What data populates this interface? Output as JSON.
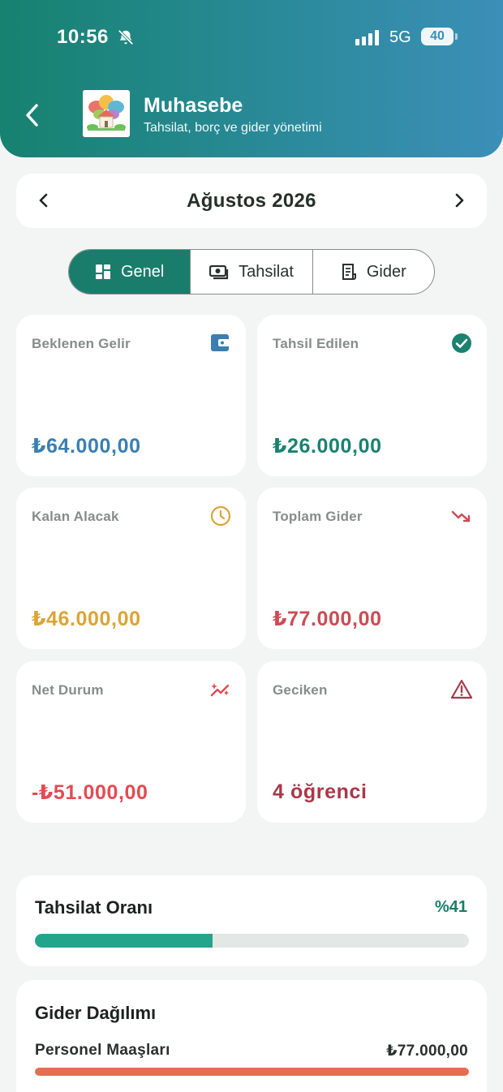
{
  "status_bar": {
    "time": "10:56",
    "network": "5G",
    "battery": "40"
  },
  "header": {
    "title": "Muhasebe",
    "subtitle": "Tahsilat, borç ve gider yönetimi"
  },
  "month_selector": {
    "label": "Ağustos 2026"
  },
  "tabs": [
    {
      "label": "Genel",
      "icon": "dashboard-grid-icon",
      "active": true
    },
    {
      "label": "Tahsilat",
      "icon": "cash-icon",
      "active": false
    },
    {
      "label": "Gider",
      "icon": "receipt-icon",
      "active": false
    }
  ],
  "stats": [
    {
      "label": "Beklenen Gelir",
      "value": "₺64.000,00",
      "icon": "wallet-icon",
      "color": "#3a7fb0"
    },
    {
      "label": "Tahsil Edilen",
      "value": "₺26.000,00",
      "icon": "check-circle-icon",
      "color": "#198270"
    },
    {
      "label": "Kalan Alacak",
      "value": "₺46.000,00",
      "icon": "clock-icon",
      "color": "#dca437"
    },
    {
      "label": "Toplam Gider",
      "value": "₺77.000,00",
      "icon": "trending-down-icon",
      "color": "#cc4b53"
    },
    {
      "label": "Net Durum",
      "value": "-₺51.000,00",
      "icon": "sparkle-trend-icon",
      "color": "#e44a52"
    },
    {
      "label": "Geciken",
      "value": "4 öğrenci",
      "icon": "warning-icon",
      "color": "#a8384a"
    }
  ],
  "collection_rate": {
    "title": "Tahsilat Oranı",
    "percent_label": "%41",
    "progress": 0.41,
    "color": "#23a58c"
  },
  "expense_distribution": {
    "title": "Gider Dağılımı",
    "items": [
      {
        "name": "Personel Maaşları",
        "amount": "₺77.000,00",
        "share": 1.0,
        "color": "#e56d52"
      }
    ]
  }
}
